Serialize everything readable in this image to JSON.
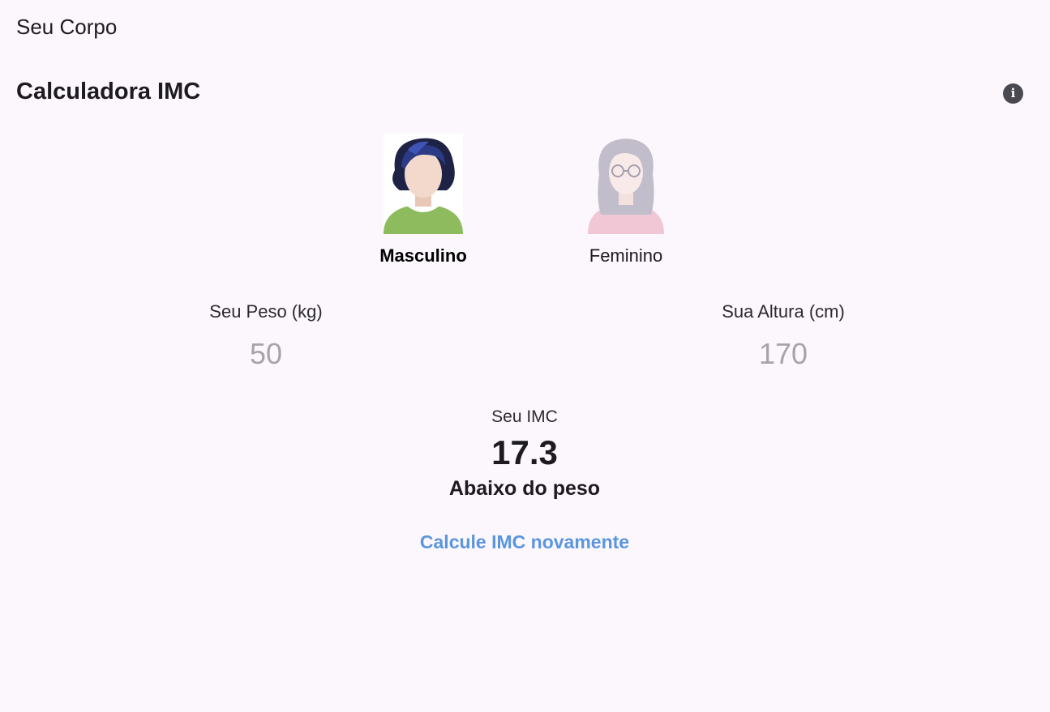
{
  "app": {
    "title": "Seu Corpo"
  },
  "calculator": {
    "title": "Calculadora IMC",
    "info_icon": "info-icon"
  },
  "genders": {
    "male": {
      "label": "Masculino",
      "selected": true
    },
    "female": {
      "label": "Feminino",
      "selected": false
    }
  },
  "inputs": {
    "weight": {
      "label": "Seu Peso (kg)",
      "value": "50"
    },
    "height": {
      "label": "Sua Altura (cm)",
      "value": "170"
    }
  },
  "result": {
    "label": "Seu IMC",
    "value": "17.3",
    "status": "Abaixo do peso"
  },
  "actions": {
    "recalculate": "Calcule IMC novamente"
  },
  "colors": {
    "background": "#fcf7fc",
    "accent_link": "#5a95e0",
    "input_text": "#a6a3aa"
  }
}
